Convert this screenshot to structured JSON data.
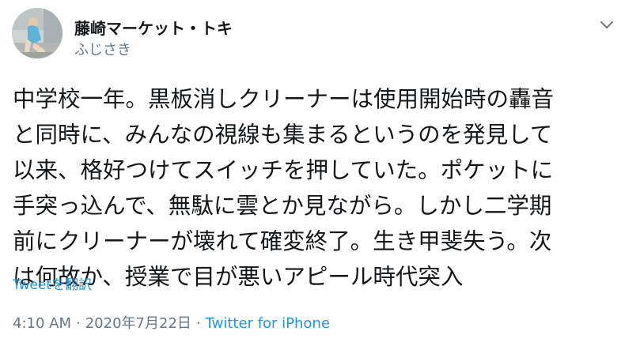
{
  "tweet": {
    "author": {
      "display_name": "藤崎マーケット・トキ",
      "handle": "ふじさき"
    },
    "body_lines": [
      "中学校一年。黒板消しクリーナーは使用開始時の轟音",
      "と同時に、みんなの視線も集まるというのを発見して",
      "以来、格好つけてスイッチを押していた。ポケットに",
      "手突っ込んで、無駄に雲とか見ながら。しかし二学期",
      "前にクリーナーが壊れて確変終了。生き甲斐失う。次",
      "は何故か、授業で目が悪いアピール時代突入"
    ],
    "translate_label": "Tweetを翻訳",
    "time": "4:10 AM",
    "separator_1": "·",
    "date": "2020年7月22日",
    "separator_2": "·",
    "source": "Twitter for iPhone"
  },
  "colors": {
    "text_primary": "#14171a",
    "text_secondary": "#657786",
    "link": "#1b95e0"
  },
  "icons": {
    "menu": "chevron-down-icon",
    "avatar": "avatar"
  }
}
